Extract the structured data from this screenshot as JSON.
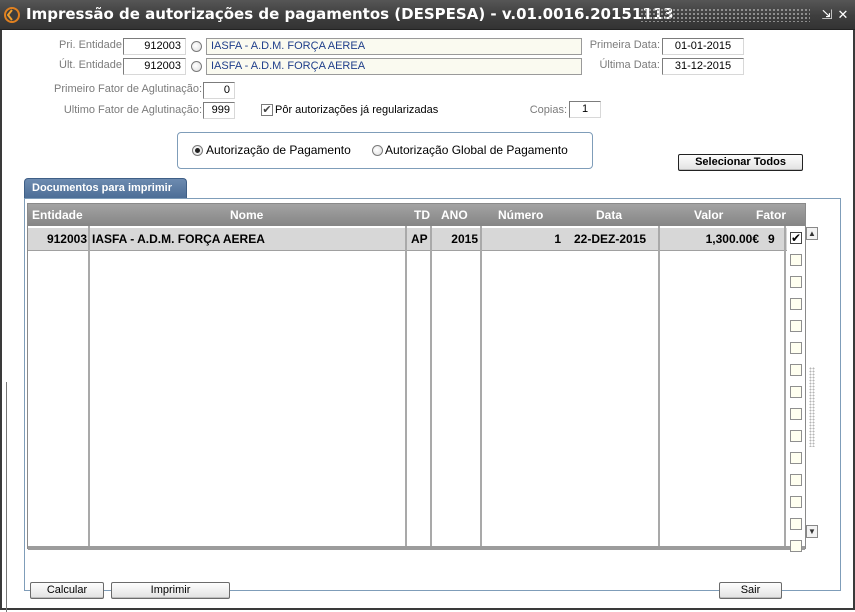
{
  "window": {
    "title": "Impressão de autorizações de pagamentos (DESPESA) - v.01.0016.20151113",
    "minimize_glyph": "⇲",
    "close_glyph": "✕"
  },
  "form": {
    "pri_entidade_label": "Pri. Entidade",
    "pri_entidade_code": "912003",
    "pri_entidade_name": "IASFA - A.D.M. FORÇA AEREA",
    "ult_entidade_label": "Últ. Entidade",
    "ult_entidade_code": "912003",
    "ult_entidade_name": "IASFA - A.D.M. FORÇA AEREA",
    "primeira_data_label": "Primeira Data:",
    "primeira_data": "01-01-2015",
    "ultima_data_label": "Última Data:",
    "ultima_data": "31-12-2015",
    "primeiro_fator_label": "Primeiro Fator de Aglutinação:",
    "primeiro_fator": "0",
    "ultimo_fator_label": "Ultimo Fator de Aglutinação:",
    "ultimo_fator": "999",
    "regularizadas_label": "Pôr autorizações já regularizadas",
    "regularizadas_checked": true,
    "copias_label": "Copias:",
    "copias": "1"
  },
  "options": {
    "opt1": "Autorização de Pagamento",
    "opt2": "Autorização Global de Pagamento",
    "selected": "opt1"
  },
  "select_all_label": "Selecionar Todos",
  "tab_label": "Documentos para imprimir",
  "table": {
    "headers": {
      "entidade": "Entidade",
      "nome": "Nome",
      "td": "TD",
      "ano": "ANO",
      "numero": "Número",
      "data": "Data",
      "valor": "Valor",
      "fator": "Fator"
    },
    "rows": [
      {
        "entidade": "912003",
        "nome": "IASFA - A.D.M. FORÇA AEREA",
        "td": "AP",
        "ano": "2015",
        "numero": "1",
        "data": "22-DEZ-2015",
        "valor": "1,300.00€",
        "fator": "9",
        "checked": true
      }
    ]
  },
  "buttons": {
    "calcular": "Calcular",
    "imprimir": "Imprimir",
    "sair": "Sair"
  },
  "icons": {
    "app": "app-logo-icon",
    "radio": "radio-button-icon",
    "checkbox_check": "✔",
    "scroll_up": "▲",
    "scroll_down": "▼"
  }
}
